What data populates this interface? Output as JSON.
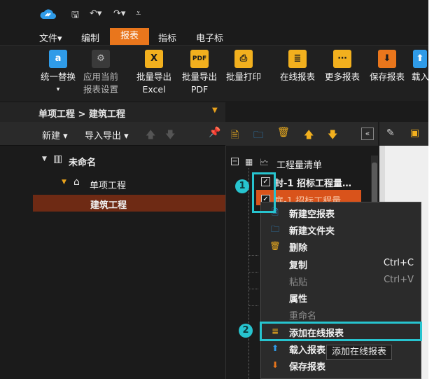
{
  "quick_access": {
    "logo_icon": "cloud-link-icon",
    "save_icon": "save-icon",
    "undo_icon": "undo-icon",
    "redo_icon": "redo-icon",
    "customize_icon": "customize-arrow-icon"
  },
  "menus": {
    "file": "文件",
    "edit": "编制",
    "report": "报表",
    "index": "指标",
    "electronic": "电子标"
  },
  "ribbon": {
    "replace_all": "统一替换",
    "apply_current_line1": "应用当前",
    "apply_current_line2": "报表设置",
    "export_excel_line1": "批量导出",
    "export_excel_line2": "Excel",
    "export_pdf_line1": "批量导出",
    "export_pdf_line2": "PDF",
    "batch_print": "批量打印",
    "online_report": "在线报表",
    "more_reports": "更多报表",
    "save_report": "保存报表",
    "load_report": "载入"
  },
  "breadcrumb": {
    "text": "单项工程 > 建筑工程"
  },
  "left_toolbar": {
    "new": "新建",
    "import_export": "导入导出"
  },
  "left_tree": {
    "root": "未命名",
    "child": "单项工程",
    "leaf": "建筑工程"
  },
  "mid_tree": {
    "root": "工程量清单",
    "item1": "封-1 招标工程量…",
    "item2": "扉-1 招标工程量…"
  },
  "context_menu": {
    "new_blank": "新建空报表",
    "new_folder": "新建文件夹",
    "delete": "删除",
    "copy": "复制",
    "copy_shortcut": "Ctrl+C",
    "paste": "粘贴",
    "paste_shortcut": "Ctrl+V",
    "properties": "属性",
    "rename": "重命名",
    "add_online": "添加在线报表",
    "load_report": "载入报表",
    "save_report": "保存报表"
  },
  "callouts": {
    "badge1": "1",
    "badge2": "2"
  },
  "tooltip": {
    "text": "添加在线报表"
  },
  "colors": {
    "accent": "#e9761c",
    "callout": "#27c4cf",
    "selected_row": "#6e2a14",
    "orange_row": "#d9531b"
  }
}
